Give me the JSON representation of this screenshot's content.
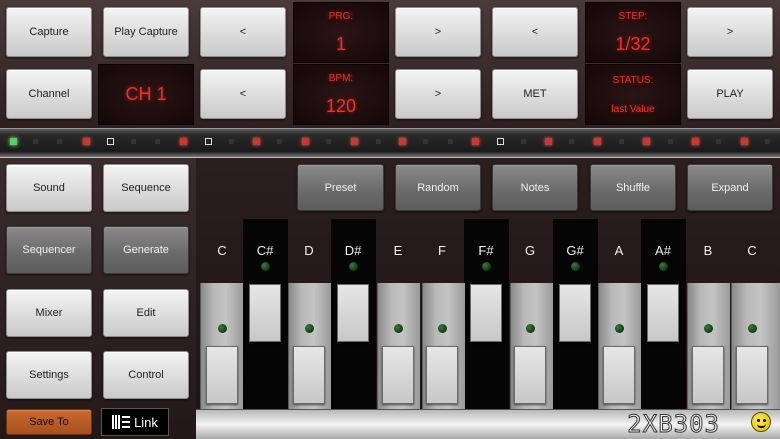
{
  "top": {
    "capture": "Capture",
    "play_capture": "Play Capture",
    "prev1": "<",
    "prg_label": "PRG:",
    "prg_value": "1",
    "next1": ">",
    "prev2": "<",
    "step_label": "STEP:",
    "step_value": "1/32",
    "next2": ">",
    "channel": "Channel",
    "channel_value": "CH 1",
    "prev3": "<",
    "bpm_label": "BPM:",
    "bpm_value": "120",
    "next3": ">",
    "met": "MET",
    "status_label": "STATUS:",
    "status_value": "last Value",
    "play": "PLAY"
  },
  "left": {
    "sound": "Sound",
    "sequence": "Sequence",
    "sequencer": "Sequencer",
    "generate": "Generate",
    "mixer": "Mixer",
    "edit": "Edit",
    "settings": "Settings",
    "control": "Control",
    "save_to": "Save To",
    "link": "Link"
  },
  "toolbar": {
    "preset": "Preset",
    "random": "Random",
    "notes": "Notes",
    "shuffle": "Shuffle",
    "expand": "Expand"
  },
  "notes": [
    "C",
    "C#",
    "D",
    "D#",
    "E",
    "F",
    "F#",
    "G",
    "G#",
    "A",
    "A#",
    "B",
    "C"
  ],
  "brand": "2XB303",
  "colors": {
    "lcd_red": "#e8322a",
    "led_red": "#c73a34",
    "led_green": "#58d060",
    "save_orange": "#c86a30"
  }
}
